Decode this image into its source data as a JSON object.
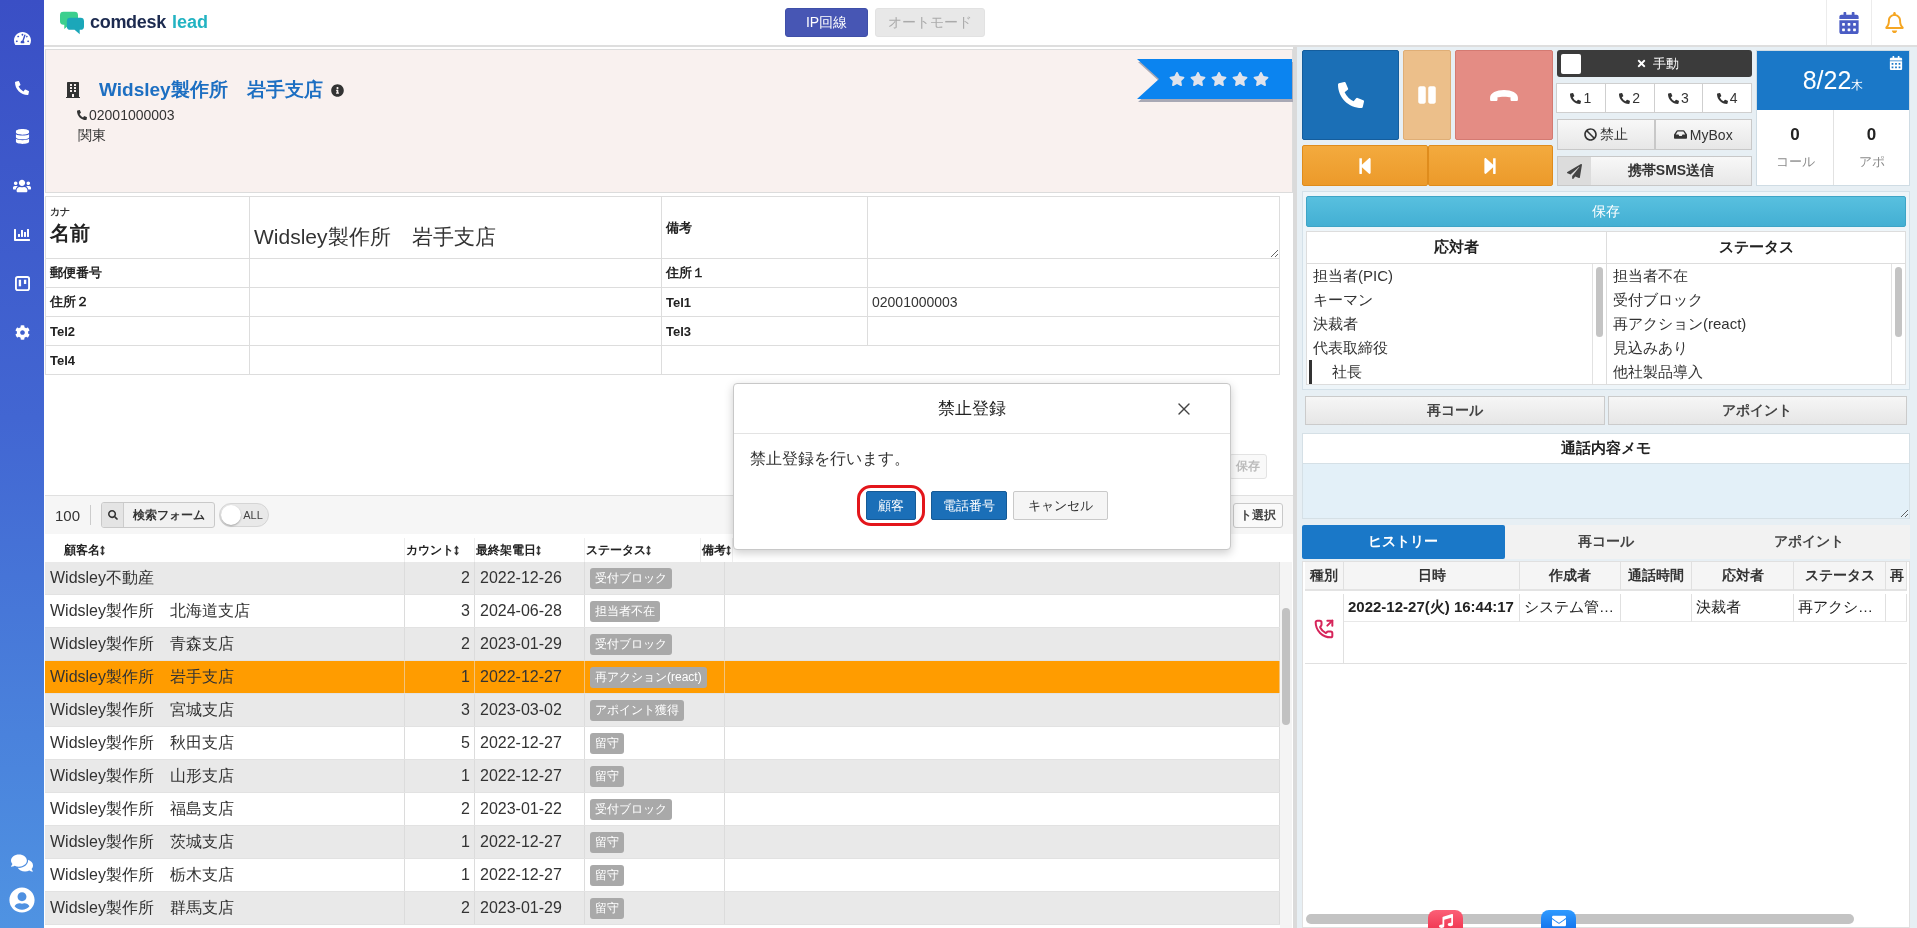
{
  "header": {
    "logo": {
      "name": "comdesk",
      "suffix": "lead"
    },
    "modes": [
      {
        "label": "IP回線",
        "selected": true
      },
      {
        "label": "オートモード",
        "selected": false
      }
    ]
  },
  "customer": {
    "name": "Widsley製作所　岩手支店",
    "phone": "02001000003",
    "region": "関東",
    "stars": 5
  },
  "form": {
    "rows": [
      [
        {
          "kind": "name",
          "kana": "カナ",
          "label": "名前",
          "value": "Widsley製作所　岩手支店"
        },
        {
          "kind": "textarea",
          "label": "備考"
        }
      ],
      [
        {
          "kind": "text",
          "label": "郵便番号"
        },
        {
          "kind": "text",
          "label": "住所１"
        }
      ],
      [
        {
          "kind": "text",
          "label": "住所２"
        },
        {
          "kind": "text",
          "label": "Tel1",
          "value": "02001000003"
        }
      ],
      [
        {
          "kind": "text",
          "label": "Tel2"
        },
        {
          "kind": "text",
          "label": "Tel3"
        }
      ],
      [
        {
          "kind": "text",
          "label": "Tel4"
        }
      ]
    ],
    "save": {
      "label": "保存",
      "disabled": true
    }
  },
  "list_toolbar": {
    "page_size": "100",
    "search_button": "検索フォーム",
    "toggle": {
      "label": "ALL",
      "on": false
    },
    "select_button": "ト選択"
  },
  "customers": {
    "columns": [
      "顧客名",
      "カウント",
      "最終架電日",
      "ステータス",
      "備考"
    ],
    "rows": [
      {
        "name": "Widsley不動産",
        "count": "2",
        "date": "2022-12-26",
        "status": "受付ブロック",
        "selected": false
      },
      {
        "name": "Widsley製作所　北海道支店",
        "count": "3",
        "date": "2024-06-28",
        "status": "担当者不在",
        "selected": false
      },
      {
        "name": "Widsley製作所　青森支店",
        "count": "2",
        "date": "2023-01-29",
        "status": "受付ブロック",
        "selected": false
      },
      {
        "name": "Widsley製作所　岩手支店",
        "count": "1",
        "date": "2022-12-27",
        "status": "再アクション(react)",
        "selected": true
      },
      {
        "name": "Widsley製作所　宮城支店",
        "count": "3",
        "date": "2023-03-02",
        "status": "アポイント獲得",
        "selected": false
      },
      {
        "name": "Widsley製作所　秋田支店",
        "count": "5",
        "date": "2022-12-27",
        "status": "留守",
        "selected": false
      },
      {
        "name": "Widsley製作所　山形支店",
        "count": "1",
        "date": "2022-12-27",
        "status": "留守",
        "selected": false
      },
      {
        "name": "Widsley製作所　福島支店",
        "count": "2",
        "date": "2023-01-22",
        "status": "受付ブロック",
        "selected": false
      },
      {
        "name": "Widsley製作所　茨城支店",
        "count": "1",
        "date": "2022-12-27",
        "status": "留守",
        "selected": false
      },
      {
        "name": "Widsley製作所　栃木支店",
        "count": "1",
        "date": "2022-12-27",
        "status": "留守",
        "selected": false
      },
      {
        "name": "Widsley製作所　群馬支店",
        "count": "2",
        "date": "2023-01-29",
        "status": "留守",
        "selected": false
      }
    ]
  },
  "dialog": {
    "title": "禁止登録",
    "message": "禁止登録を行います。",
    "buttons": [
      {
        "label": "顧客",
        "kind": "primary",
        "highlighted": true
      },
      {
        "label": "電話番号",
        "kind": "primary",
        "highlighted": false
      },
      {
        "label": "キャンセル",
        "kind": "default",
        "highlighted": false
      }
    ]
  },
  "phone_panel": {
    "manual": {
      "label": "手動",
      "checked": false
    },
    "lines": [
      "1",
      "2",
      "3",
      "4"
    ],
    "actions": [
      {
        "kind": "ban",
        "label": "禁止"
      },
      {
        "kind": "inbox",
        "label": "MyBox"
      }
    ],
    "sms": "携帯SMS送信",
    "date": {
      "day": "8/22",
      "weekday": "木"
    },
    "counters": [
      {
        "value": "0",
        "label": "コール"
      },
      {
        "value": "0",
        "label": "アポ"
      }
    ],
    "save": "保存",
    "pickers": [
      {
        "title": "応対者",
        "items": [
          {
            "label": "担当者(PIC)",
            "selected": false
          },
          {
            "label": "キーマン",
            "selected": false
          },
          {
            "label": "決裁者",
            "selected": false
          },
          {
            "label": "代表取締役",
            "selected": false,
            "children": [
              {
                "label": "社長",
                "selected": false
              }
            ]
          }
        ]
      },
      {
        "title": "ステータス",
        "items": [
          {
            "label": "担当者不在",
            "selected": false
          },
          {
            "label": "受付ブロック",
            "selected": false
          },
          {
            "label": "再アクション(react)",
            "selected": false
          },
          {
            "label": "見込みあり",
            "selected": false
          },
          {
            "label": "他社製品導入",
            "selected": false
          }
        ]
      }
    ],
    "schedule_buttons": [
      "再コール",
      "アポイント"
    ],
    "memo": {
      "title": "通話内容メモ"
    },
    "tabs": [
      {
        "label": "ヒストリー",
        "selected": true
      },
      {
        "label": "再コール",
        "selected": false
      },
      {
        "label": "アポイント",
        "selected": false
      }
    ],
    "history": {
      "columns": [
        "種別",
        "日時",
        "作成者",
        "通話時間",
        "応対者",
        "ステータス",
        "再"
      ],
      "rows": [
        {
          "kind": "outgoing",
          "datetime": "2022-12-27(火) 16:44:17",
          "creator": "システム管…",
          "respondent": "決裁者",
          "status": "再アクシ…"
        }
      ]
    }
  }
}
